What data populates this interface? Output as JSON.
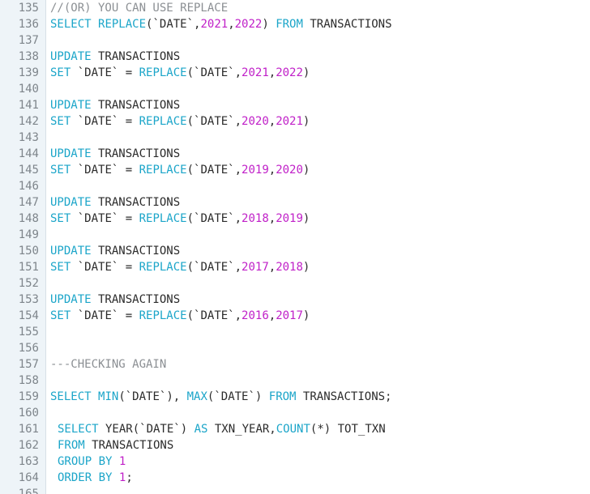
{
  "colors": {
    "keyword": "#1ba5c9",
    "number": "#c020c8",
    "comment": "#8b8f93",
    "text": "#2b2b2b",
    "gutter_bg": "#eef4f8"
  },
  "lines": [
    {
      "n": "135",
      "indent": 0,
      "tokens": [
        {
          "t": "//(OR) YOU CAN USE REPLACE",
          "k": "cm"
        }
      ]
    },
    {
      "n": "136",
      "indent": 0,
      "tokens": [
        {
          "t": "SELECT",
          "k": "kw"
        },
        {
          "t": " ",
          "k": "txt"
        },
        {
          "t": "REPLACE",
          "k": "fn"
        },
        {
          "t": "(`DATE`,",
          "k": "txt"
        },
        {
          "t": "2021",
          "k": "num"
        },
        {
          "t": ",",
          "k": "txt"
        },
        {
          "t": "2022",
          "k": "num"
        },
        {
          "t": ") ",
          "k": "txt"
        },
        {
          "t": "FROM",
          "k": "kw"
        },
        {
          "t": " TRANSACTIONS",
          "k": "txt"
        }
      ]
    },
    {
      "n": "137",
      "indent": 0,
      "tokens": []
    },
    {
      "n": "138",
      "indent": 0,
      "tokens": [
        {
          "t": "UPDATE",
          "k": "kw"
        },
        {
          "t": " TRANSACTIONS",
          "k": "txt"
        }
      ]
    },
    {
      "n": "139",
      "indent": 0,
      "tokens": [
        {
          "t": "SET",
          "k": "kw"
        },
        {
          "t": " `DATE` = ",
          "k": "txt"
        },
        {
          "t": "REPLACE",
          "k": "fn"
        },
        {
          "t": "(`DATE`,",
          "k": "txt"
        },
        {
          "t": "2021",
          "k": "num"
        },
        {
          "t": ",",
          "k": "txt"
        },
        {
          "t": "2022",
          "k": "num"
        },
        {
          "t": ")",
          "k": "txt"
        }
      ]
    },
    {
      "n": "140",
      "indent": 0,
      "tokens": []
    },
    {
      "n": "141",
      "indent": 0,
      "tokens": [
        {
          "t": "UPDATE",
          "k": "kw"
        },
        {
          "t": " TRANSACTIONS",
          "k": "txt"
        }
      ]
    },
    {
      "n": "142",
      "indent": 0,
      "tokens": [
        {
          "t": "SET",
          "k": "kw"
        },
        {
          "t": " `DATE` = ",
          "k": "txt"
        },
        {
          "t": "REPLACE",
          "k": "fn"
        },
        {
          "t": "(`DATE`,",
          "k": "txt"
        },
        {
          "t": "2020",
          "k": "num"
        },
        {
          "t": ",",
          "k": "txt"
        },
        {
          "t": "2021",
          "k": "num"
        },
        {
          "t": ")",
          "k": "txt"
        }
      ]
    },
    {
      "n": "143",
      "indent": 0,
      "tokens": []
    },
    {
      "n": "144",
      "indent": 0,
      "tokens": [
        {
          "t": "UPDATE",
          "k": "kw"
        },
        {
          "t": " TRANSACTIONS",
          "k": "txt"
        }
      ]
    },
    {
      "n": "145",
      "indent": 0,
      "tokens": [
        {
          "t": "SET",
          "k": "kw"
        },
        {
          "t": " `DATE` = ",
          "k": "txt"
        },
        {
          "t": "REPLACE",
          "k": "fn"
        },
        {
          "t": "(`DATE`,",
          "k": "txt"
        },
        {
          "t": "2019",
          "k": "num"
        },
        {
          "t": ",",
          "k": "txt"
        },
        {
          "t": "2020",
          "k": "num"
        },
        {
          "t": ")",
          "k": "txt"
        }
      ]
    },
    {
      "n": "146",
      "indent": 0,
      "tokens": []
    },
    {
      "n": "147",
      "indent": 0,
      "tokens": [
        {
          "t": "UPDATE",
          "k": "kw"
        },
        {
          "t": " TRANSACTIONS",
          "k": "txt"
        }
      ]
    },
    {
      "n": "148",
      "indent": 0,
      "tokens": [
        {
          "t": "SET",
          "k": "kw"
        },
        {
          "t": " `DATE` = ",
          "k": "txt"
        },
        {
          "t": "REPLACE",
          "k": "fn"
        },
        {
          "t": "(`DATE`,",
          "k": "txt"
        },
        {
          "t": "2018",
          "k": "num"
        },
        {
          "t": ",",
          "k": "txt"
        },
        {
          "t": "2019",
          "k": "num"
        },
        {
          "t": ")",
          "k": "txt"
        }
      ]
    },
    {
      "n": "149",
      "indent": 0,
      "tokens": []
    },
    {
      "n": "150",
      "indent": 0,
      "tokens": [
        {
          "t": "UPDATE",
          "k": "kw"
        },
        {
          "t": " TRANSACTIONS",
          "k": "txt"
        }
      ]
    },
    {
      "n": "151",
      "indent": 0,
      "tokens": [
        {
          "t": "SET",
          "k": "kw"
        },
        {
          "t": " `DATE` = ",
          "k": "txt"
        },
        {
          "t": "REPLACE",
          "k": "fn"
        },
        {
          "t": "(`DATE`,",
          "k": "txt"
        },
        {
          "t": "2017",
          "k": "num"
        },
        {
          "t": ",",
          "k": "txt"
        },
        {
          "t": "2018",
          "k": "num"
        },
        {
          "t": ")",
          "k": "txt"
        }
      ]
    },
    {
      "n": "152",
      "indent": 0,
      "tokens": []
    },
    {
      "n": "153",
      "indent": 0,
      "tokens": [
        {
          "t": "UPDATE",
          "k": "kw"
        },
        {
          "t": " TRANSACTIONS",
          "k": "txt"
        }
      ]
    },
    {
      "n": "154",
      "indent": 0,
      "tokens": [
        {
          "t": "SET",
          "k": "kw"
        },
        {
          "t": " `DATE` = ",
          "k": "txt"
        },
        {
          "t": "REPLACE",
          "k": "fn"
        },
        {
          "t": "(`DATE`,",
          "k": "txt"
        },
        {
          "t": "2016",
          "k": "num"
        },
        {
          "t": ",",
          "k": "txt"
        },
        {
          "t": "2017",
          "k": "num"
        },
        {
          "t": ")",
          "k": "txt"
        }
      ]
    },
    {
      "n": "155",
      "indent": 0,
      "tokens": []
    },
    {
      "n": "156",
      "indent": 0,
      "tokens": []
    },
    {
      "n": "157",
      "indent": 0,
      "tokens": [
        {
          "t": "---CHECKING AGAIN",
          "k": "cm"
        }
      ]
    },
    {
      "n": "158",
      "indent": 0,
      "tokens": []
    },
    {
      "n": "159",
      "indent": 0,
      "tokens": [
        {
          "t": "SELECT",
          "k": "kw"
        },
        {
          "t": " ",
          "k": "txt"
        },
        {
          "t": "MIN",
          "k": "fn"
        },
        {
          "t": "(`DATE`), ",
          "k": "txt"
        },
        {
          "t": "MAX",
          "k": "fn"
        },
        {
          "t": "(`DATE`) ",
          "k": "txt"
        },
        {
          "t": "FROM",
          "k": "kw"
        },
        {
          "t": " TRANSACTIONS;",
          "k": "txt"
        }
      ]
    },
    {
      "n": "160",
      "indent": 0,
      "tokens": []
    },
    {
      "n": "161",
      "indent": 1,
      "tokens": [
        {
          "t": "SELECT",
          "k": "kw"
        },
        {
          "t": " YEAR(`DATE`) ",
          "k": "txt"
        },
        {
          "t": "AS",
          "k": "kw"
        },
        {
          "t": " TXN_YEAR,",
          "k": "txt"
        },
        {
          "t": "COUNT",
          "k": "fn"
        },
        {
          "t": "(*) TOT_TXN",
          "k": "txt"
        }
      ]
    },
    {
      "n": "162",
      "indent": 1,
      "tokens": [
        {
          "t": "FROM",
          "k": "kw"
        },
        {
          "t": " TRANSACTIONS",
          "k": "txt"
        }
      ]
    },
    {
      "n": "163",
      "indent": 1,
      "tokens": [
        {
          "t": "GROUP BY",
          "k": "kw"
        },
        {
          "t": " ",
          "k": "txt"
        },
        {
          "t": "1",
          "k": "num"
        }
      ]
    },
    {
      "n": "164",
      "indent": 1,
      "tokens": [
        {
          "t": "ORDER BY",
          "k": "kw"
        },
        {
          "t": " ",
          "k": "txt"
        },
        {
          "t": "1",
          "k": "num"
        },
        {
          "t": ";",
          "k": "txt"
        }
      ]
    },
    {
      "n": "165",
      "indent": 0,
      "tokens": []
    }
  ]
}
